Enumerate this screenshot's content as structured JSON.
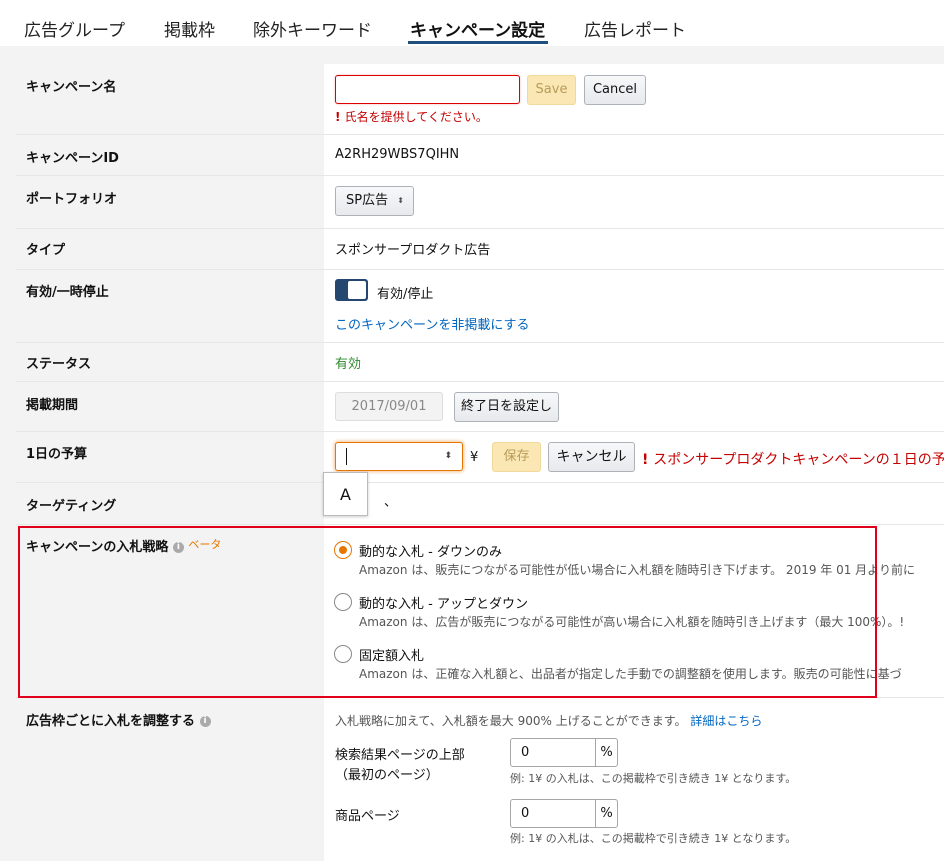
{
  "tabs": [
    {
      "label": "広告グループ"
    },
    {
      "label": "掲載枠"
    },
    {
      "label": "除外キーワード"
    },
    {
      "label": "キャンペーン設定"
    },
    {
      "label": "広告レポート"
    }
  ],
  "campaign_name": {
    "label": "キャンペーン名",
    "value": "",
    "save": "Save",
    "cancel": "Cancel",
    "error": "氏名を提供してください。"
  },
  "campaign_id": {
    "label": "キャンペーンID",
    "value": "A2RH29WBS7QIHN"
  },
  "portfolio": {
    "label": "ポートフォリオ",
    "value": "SP広告"
  },
  "type": {
    "label": "タイプ",
    "value": "スポンサープロダクト広告"
  },
  "active": {
    "label": "有効/一時停止",
    "toggle_label": "有効/停止",
    "archive_link": "このキャンペーンを非掲載にする"
  },
  "status": {
    "label": "ステータス",
    "value": "有効"
  },
  "period": {
    "label": "掲載期間",
    "start": "2017/09/01",
    "set_end": "終了日を設定し"
  },
  "budget": {
    "label": "1日の予算",
    "value": "",
    "currency": "¥",
    "save": "保存",
    "cancel": "キャンセル",
    "error": "スポンサープロダクトキャンペーンの１日の予算に"
  },
  "tooltip": {
    "text": "A"
  },
  "targeting": {
    "label": "ターゲティング",
    "value": "、"
  },
  "bidding": {
    "label": "キャンペーンの入札戦略",
    "beta": "ベータ",
    "options": [
      {
        "title": "動的な入札 - ダウンのみ",
        "desc": "Amazon は、販売につながる可能性が低い場合に入札額を随時引き下げます。 2019 年 01 月より前に",
        "selected": true
      },
      {
        "title": "動的な入札 - アップとダウン",
        "desc": "Amazon は、広告が販売につながる可能性が高い場合に入札額を随時引き上げます（最大 100%）。!",
        "selected": false
      },
      {
        "title": "固定額入札",
        "desc": "Amazon は、正確な入札額と、出品者が指定した手動での調整額を使用します。販売の可能性に基づ",
        "selected": false
      }
    ]
  },
  "placement": {
    "label": "広告枠ごとに入札を調整する",
    "intro": "入札戦略に加えて、入札額を最大 900% 上げることができます。",
    "details_link": "詳細はこちら",
    "items": [
      {
        "label_line1": "検索結果ページの上部",
        "label_line2": "（最初のページ）",
        "value": "0",
        "unit": "%",
        "hint": "例: 1¥ の入札は、この掲載枠で引き続き 1¥ となります。"
      },
      {
        "label_line1": "商品ページ",
        "label_line2": "",
        "value": "0",
        "unit": "%",
        "hint": "例: 1¥ の入札は、この掲載枠で引き続き 1¥ となります。"
      }
    ]
  }
}
